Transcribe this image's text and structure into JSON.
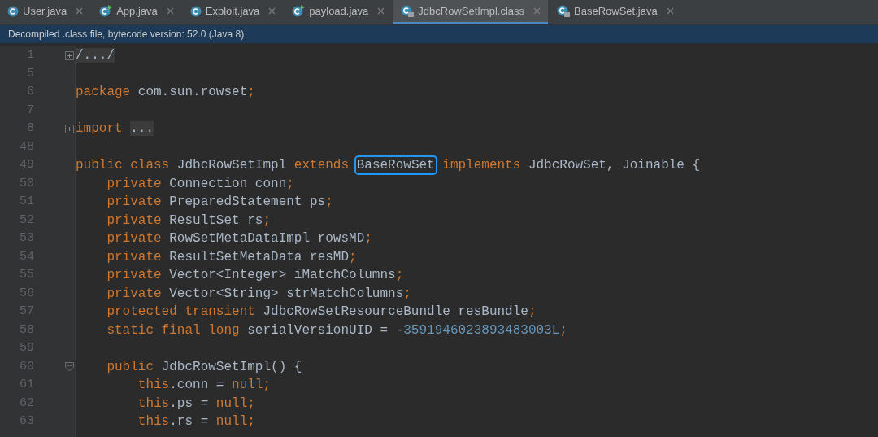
{
  "tabs": [
    {
      "label": "User.java",
      "kind": "class",
      "selected": false
    },
    {
      "label": "App.java",
      "kind": "runnable",
      "selected": false
    },
    {
      "label": "Exploit.java",
      "kind": "class",
      "selected": false
    },
    {
      "label": "payload.java",
      "kind": "runnable",
      "selected": false
    },
    {
      "label": "JdbcRowSetImpl.class",
      "kind": "locked",
      "selected": true
    },
    {
      "label": "BaseRowSet.java",
      "kind": "locked",
      "selected": false
    }
  ],
  "banner": "Decompiled .class file, bytecode version: 52.0 (Java 8)",
  "lines": [
    {
      "number": "1",
      "kind": "folded",
      "segments": [
        {
          "text": "/.../",
          "kind": "folded"
        }
      ]
    },
    {
      "number": "5",
      "kind": "plain"
    },
    {
      "number": "6",
      "kind": "plain",
      "segments": [
        {
          "text": "package ",
          "kind": "kw"
        },
        {
          "text": "com.sun.rowset",
          "kind": "plain"
        },
        {
          "text": ";",
          "kind": "kw"
        }
      ]
    },
    {
      "number": "7",
      "kind": "plain"
    },
    {
      "number": "8",
      "kind": "folded",
      "segments": [
        {
          "text": "import ",
          "kind": "kw"
        },
        {
          "text": "...",
          "kind": "folded"
        }
      ]
    },
    {
      "number": "48",
      "kind": "plain"
    },
    {
      "number": "49",
      "kind": "plain",
      "segments": [
        {
          "text": "public class ",
          "kind": "kw"
        },
        {
          "text": "JdbcRowSetImpl ",
          "kind": "plain"
        },
        {
          "text": "extends ",
          "kind": "kw"
        },
        {
          "text": "BaseRowSet",
          "kind": "boxed"
        },
        {
          "text": " implements ",
          "kind": "kw"
        },
        {
          "text": "JdbcRowSet, Joinable {",
          "kind": "plain"
        }
      ]
    },
    {
      "number": "50",
      "kind": "plain",
      "segments": [
        {
          "text": "    private ",
          "kind": "kw"
        },
        {
          "text": "Connection conn",
          "kind": "plain"
        },
        {
          "text": ";",
          "kind": "kw"
        }
      ]
    },
    {
      "number": "51",
      "kind": "plain",
      "segments": [
        {
          "text": "    private ",
          "kind": "kw"
        },
        {
          "text": "PreparedStatement ps",
          "kind": "plain"
        },
        {
          "text": ";",
          "kind": "kw"
        }
      ]
    },
    {
      "number": "52",
      "kind": "plain",
      "segments": [
        {
          "text": "    private ",
          "kind": "kw"
        },
        {
          "text": "ResultSet rs",
          "kind": "plain"
        },
        {
          "text": ";",
          "kind": "kw"
        }
      ]
    },
    {
      "number": "53",
      "kind": "plain",
      "segments": [
        {
          "text": "    private ",
          "kind": "kw"
        },
        {
          "text": "RowSetMetaDataImpl rowsMD",
          "kind": "plain"
        },
        {
          "text": ";",
          "kind": "kw"
        }
      ]
    },
    {
      "number": "54",
      "kind": "plain",
      "segments": [
        {
          "text": "    private ",
          "kind": "kw"
        },
        {
          "text": "ResultSetMetaData resMD",
          "kind": "plain"
        },
        {
          "text": ";",
          "kind": "kw"
        }
      ]
    },
    {
      "number": "55",
      "kind": "plain",
      "segments": [
        {
          "text": "    private ",
          "kind": "kw"
        },
        {
          "text": "Vector<Integer> iMatchColumns",
          "kind": "plain"
        },
        {
          "text": ";",
          "kind": "kw"
        }
      ]
    },
    {
      "number": "56",
      "kind": "plain",
      "segments": [
        {
          "text": "    private ",
          "kind": "kw"
        },
        {
          "text": "Vector<String> strMatchColumns",
          "kind": "plain"
        },
        {
          "text": ";",
          "kind": "kw"
        }
      ]
    },
    {
      "number": "57",
      "kind": "plain",
      "segments": [
        {
          "text": "    protected transient ",
          "kind": "kw"
        },
        {
          "text": "JdbcRowSetResourceBundle resBundle",
          "kind": "plain"
        },
        {
          "text": ";",
          "kind": "kw"
        }
      ]
    },
    {
      "number": "58",
      "kind": "plain",
      "segments": [
        {
          "text": "    static final long ",
          "kind": "kw"
        },
        {
          "text": "serialVersionUID = -",
          "kind": "plain"
        },
        {
          "text": "3591946023893483003L",
          "kind": "num"
        },
        {
          "text": ";",
          "kind": "kw"
        }
      ]
    },
    {
      "number": "59",
      "kind": "plain"
    },
    {
      "number": "60",
      "kind": "fold-start",
      "segments": [
        {
          "text": "    public ",
          "kind": "kw"
        },
        {
          "text": "JdbcRowSetImpl() {",
          "kind": "plain"
        }
      ]
    },
    {
      "number": "61",
      "kind": "plain",
      "segments": [
        {
          "text": "        this",
          "kind": "kw"
        },
        {
          "text": ".conn = ",
          "kind": "plain"
        },
        {
          "text": "null;",
          "kind": "kw"
        }
      ]
    },
    {
      "number": "62",
      "kind": "plain",
      "segments": [
        {
          "text": "        this",
          "kind": "kw"
        },
        {
          "text": ".ps = ",
          "kind": "plain"
        },
        {
          "text": "null;",
          "kind": "kw"
        }
      ]
    },
    {
      "number": "63",
      "kind": "plain",
      "segments": [
        {
          "text": "        this",
          "kind": "kw"
        },
        {
          "text": ".rs = ",
          "kind": "plain"
        },
        {
          "text": "null;",
          "kind": "kw"
        }
      ]
    }
  ]
}
